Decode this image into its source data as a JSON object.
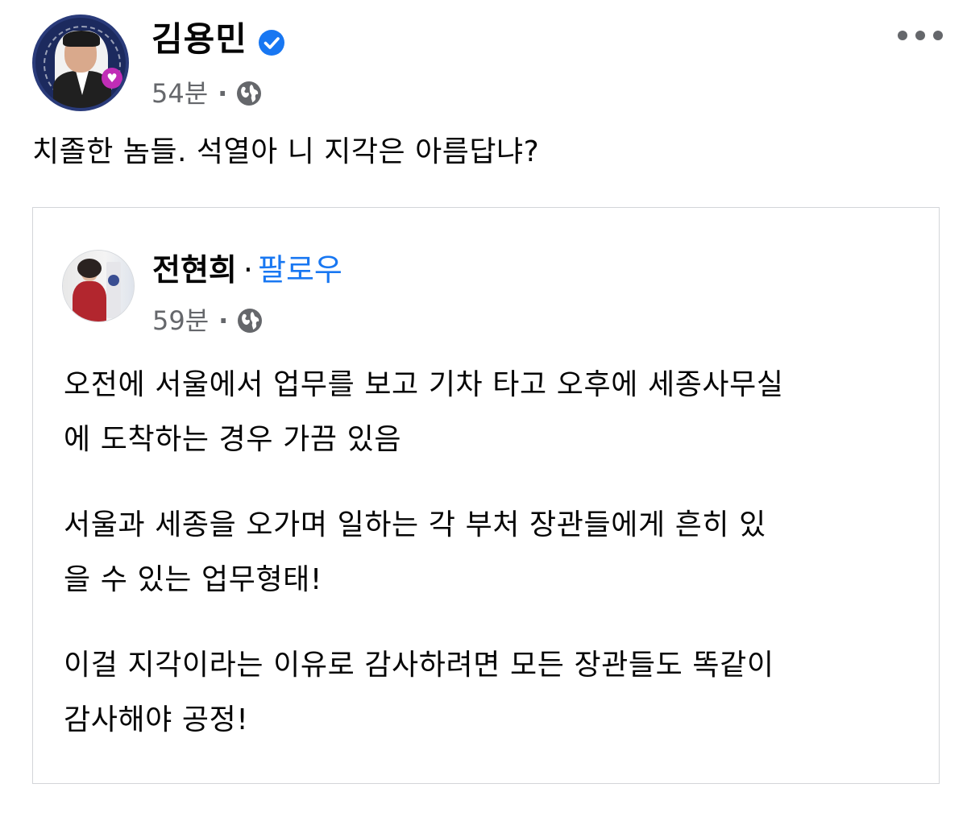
{
  "post": {
    "author": "김용민",
    "time": "54분",
    "separator": "·",
    "text": "치졸한 놈들. 석열아 니 지각은 아름답냐?"
  },
  "shared": {
    "author": "전현희",
    "separator": "·",
    "follow_label": "팔로우",
    "time": "59분",
    "paragraphs": [
      [
        "오전에 서울에서 업무를 보고 기차 타고 오후에 세종사무실",
        "에 도착하는 경우 가끔 있음"
      ],
      [
        "서울과 세종을 오가며 일하는 각 부처 장관들에게 흔히 있",
        "을 수 있는 업무형태!"
      ],
      [
        "이걸 지각이라는 이유로 감사하려면 모든 장관들도 똑같이",
        "감사해야 공정!"
      ]
    ]
  },
  "icons": {
    "verified": "verified-badge-icon",
    "audience": "globe-icon",
    "more": "more-options-icon"
  },
  "colors": {
    "verified_blue": "#1877f2",
    "follow_blue": "#1877f2",
    "meta_gray": "#65676b",
    "border_gray": "#d3d5d9"
  }
}
